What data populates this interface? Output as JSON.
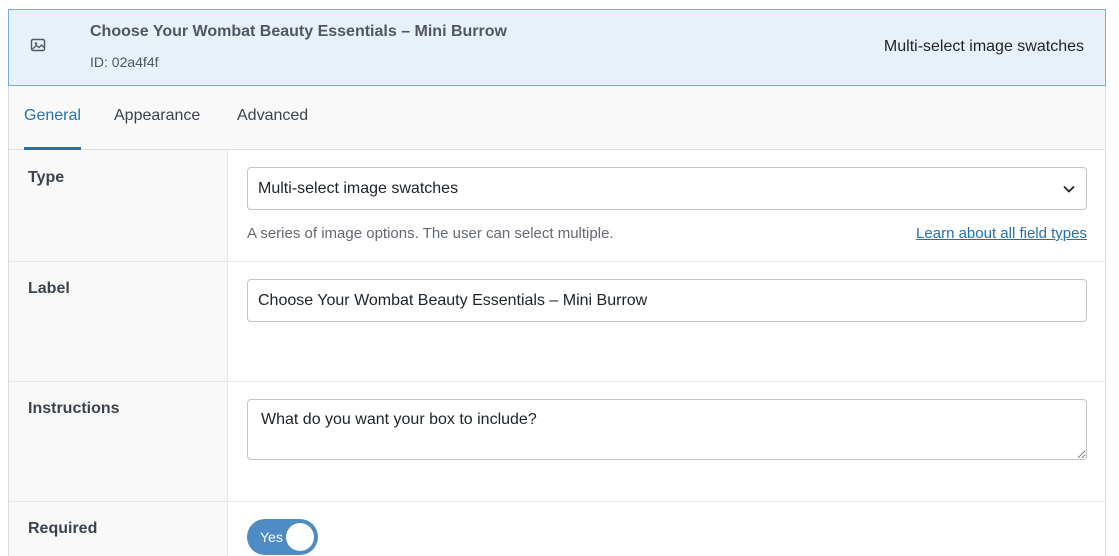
{
  "header": {
    "icon": "image-icon",
    "title": "Choose Your Wombat Beauty Essentials – Mini Burrow",
    "id_text": "ID: 02a4f4f",
    "type_label": "Multi-select image swatches"
  },
  "tabs": [
    {
      "label": "General",
      "active": true
    },
    {
      "label": "Appearance",
      "active": false
    },
    {
      "label": "Advanced",
      "active": false
    }
  ],
  "fields": {
    "type": {
      "label": "Type",
      "selected": "Multi-select image swatches",
      "help": "A series of image options. The user can select multiple.",
      "link": "Learn about all field types"
    },
    "label": {
      "label": "Label",
      "value": "Choose Your Wombat Beauty Essentials – Mini Burrow"
    },
    "instructions": {
      "label": "Instructions",
      "value": "What do you want your box to include?"
    },
    "required": {
      "label": "Required",
      "toggle_text": "Yes",
      "on": true
    }
  },
  "colors": {
    "accent": "#2271b1",
    "header_bg": "#e8f0f8",
    "toggle_on": "#4f8bc4"
  }
}
